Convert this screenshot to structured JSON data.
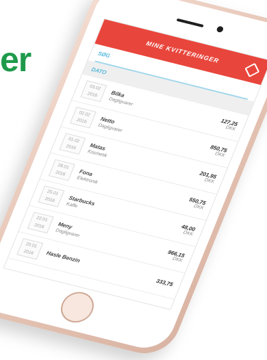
{
  "brand": {
    "fragment": "er"
  },
  "app": {
    "title": "MINE KVITTERINGER",
    "search_label": "SØG",
    "date_label": "DATO"
  },
  "receipts": [
    {
      "date_line1": "03.02",
      "date_line2": "2016",
      "merchant": "Bilka",
      "category": "Dagligvarer",
      "amount": "127,25",
      "currency": "DKK"
    },
    {
      "date_line1": "02.02",
      "date_line2": "2016",
      "merchant": "Netto",
      "category": "Dagligvarer",
      "amount": "850,75",
      "currency": "DKK"
    },
    {
      "date_line1": "01.02",
      "date_line2": "2016",
      "merchant": "Matas",
      "category": "Kosmetik",
      "amount": "201,95",
      "currency": "DKK"
    },
    {
      "date_line1": "28.01",
      "date_line2": "2016",
      "merchant": "Fona",
      "category": "Elektronik",
      "amount": "550,75",
      "currency": "DKK"
    },
    {
      "date_line1": "25.01",
      "date_line2": "2016",
      "merchant": "Starbucks",
      "category": "Kaffe",
      "amount": "48,00",
      "currency": "DKK"
    },
    {
      "date_line1": "22.01",
      "date_line2": "2016",
      "merchant": "Meny",
      "category": "Dagligvarer",
      "amount": "966,15",
      "currency": "DKK"
    },
    {
      "date_line1": "20.01",
      "date_line2": "2016",
      "merchant": "Hasle Benzin",
      "category": "",
      "amount": "333,75",
      "currency": ""
    }
  ],
  "colors": {
    "brand_green": "#1f9a4b",
    "header_red": "#e8463c",
    "accent_blue": "#55b9dd",
    "phone_gold": "#e7c7b8"
  },
  "icons": {
    "header_right": "tag-icon"
  }
}
